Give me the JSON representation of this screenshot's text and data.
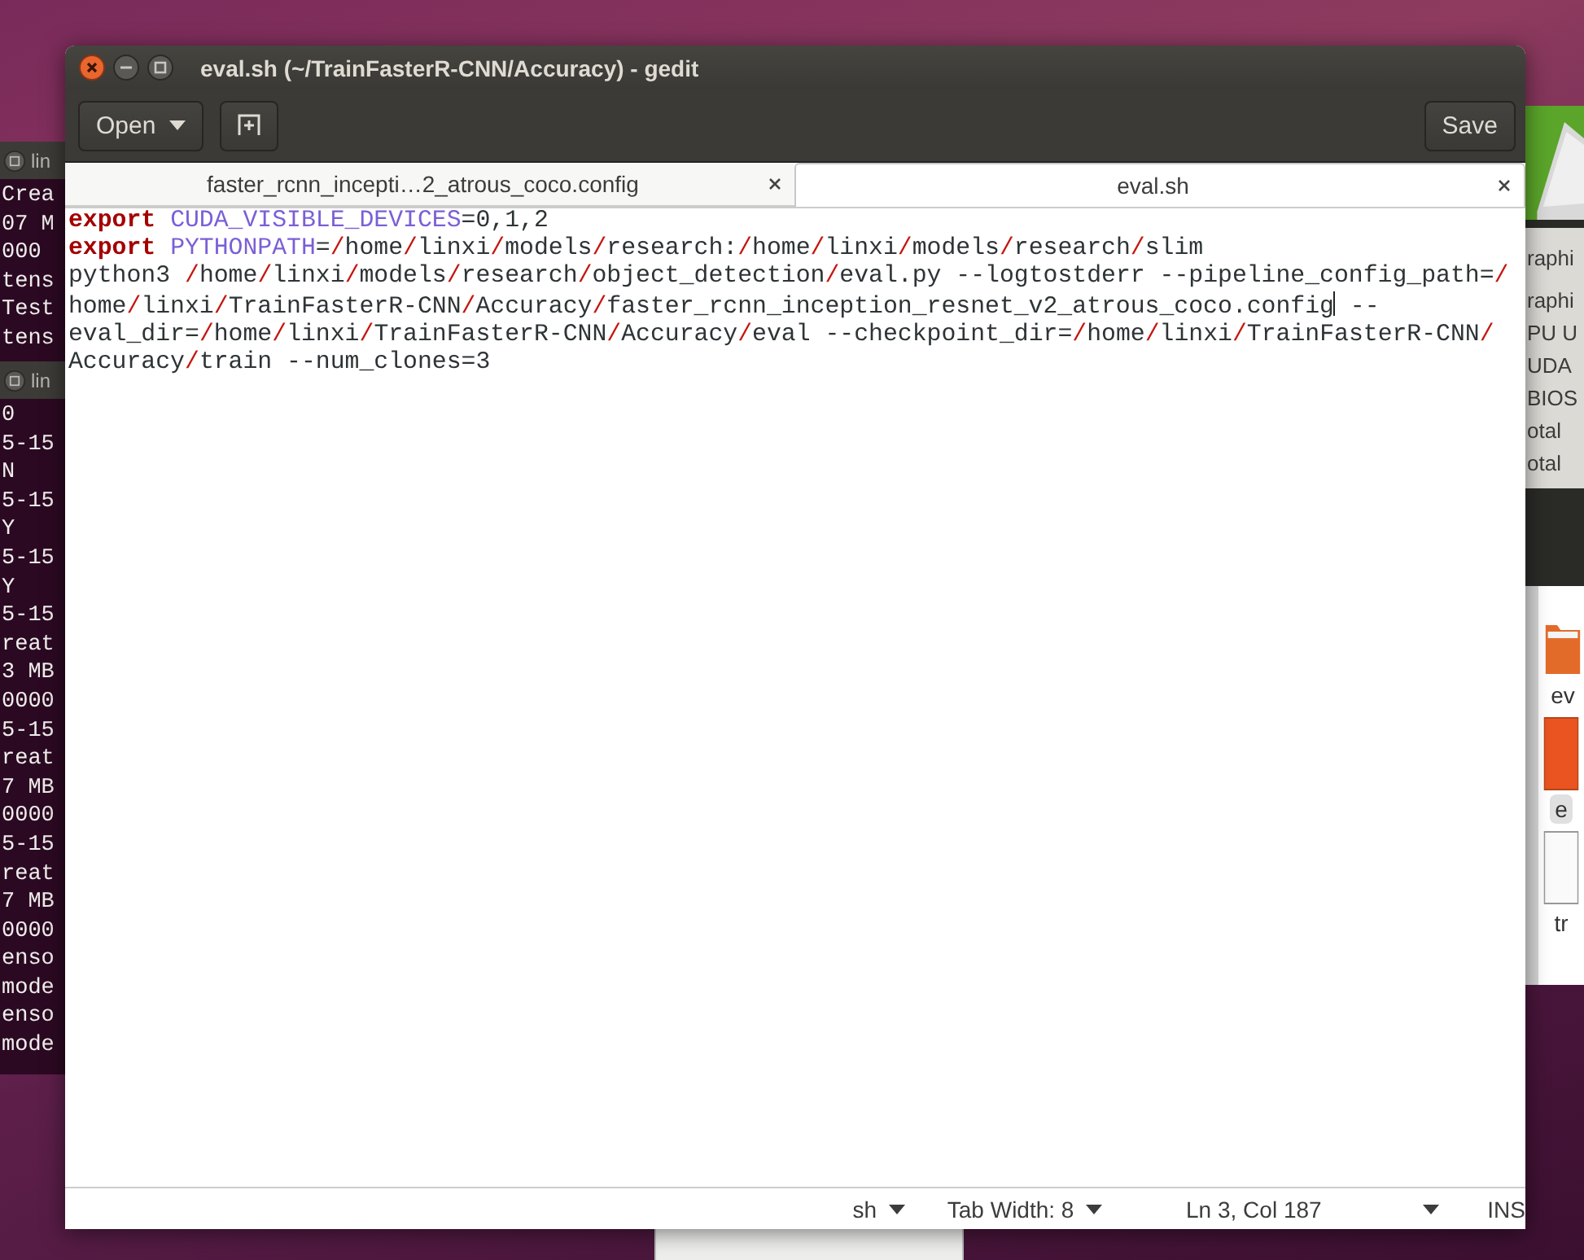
{
  "desktop": {
    "terminals": [
      {
        "title": "lin",
        "lines": [
          "Crea",
          "07 M",
          "000",
          "tens",
          "Test",
          "tens"
        ]
      },
      {
        "title": "lin",
        "lines": [
          "0",
          "5-15",
          "N",
          "5-15",
          "Y",
          "5-15",
          "Y",
          "5-15",
          "reat",
          "3 MB",
          "0000",
          "5-15",
          "reat",
          "7 MB",
          "0000",
          "5-15",
          "reat",
          "7 MB",
          "0000",
          "enso",
          "mode",
          "enso",
          "mode"
        ]
      }
    ],
    "info_window": {
      "lines": [
        "raphi",
        "raphi",
        "PU U",
        "UDA",
        "BIOS",
        "otal",
        "otal"
      ]
    },
    "files_window": {
      "items": [
        {
          "kind": "folder",
          "label": "ev",
          "selected": false
        },
        {
          "kind": "script",
          "label": "e",
          "selected": true
        },
        {
          "kind": "document",
          "label": "tr",
          "selected": false
        }
      ]
    }
  },
  "window": {
    "title": "eval.sh (~/TrainFasterR-CNN/Accuracy) - gedit",
    "toolbar": {
      "open_button": "Open",
      "save_button": "Save"
    },
    "tabs": [
      {
        "label": "faster_rcnn_incepti…2_atrous_coco.config",
        "selected": false
      },
      {
        "label": "eval.sh",
        "selected": true
      }
    ],
    "editor": {
      "rows": [
        {
          "segments": [
            {
              "kind": "keyword",
              "text": "export "
            },
            {
              "kind": "variable",
              "text": "CUDA_VISIBLE_DEVICES"
            },
            {
              "kind": "plain",
              "text": "=0,1,2"
            }
          ]
        },
        {
          "segments": [
            {
              "kind": "keyword",
              "text": "export "
            },
            {
              "kind": "variable",
              "text": "PYTHONPATH"
            },
            {
              "kind": "plain",
              "text": "=/home/linxi/models/research:/home/linxi/models/research/slim"
            }
          ]
        },
        {
          "segments": [
            {
              "kind": "plain",
              "text": "python3 /home/linxi/models/research/object_detection/eval.py --logtostderr --pipeline_config_path=/"
            }
          ]
        },
        {
          "segments": [
            {
              "kind": "plain",
              "text": "home/linxi/TrainFasterR-CNN/Accuracy/faster_rcnn_inception_resnet_v2_atrous_coco.config"
            },
            {
              "kind": "cursor"
            },
            {
              "kind": "plain",
              "text": " --"
            }
          ]
        },
        {
          "segments": [
            {
              "kind": "plain",
              "text": "eval_dir=/home/linxi/TrainFasterR-CNN/Accuracy/eval --checkpoint_dir=/home/linxi/TrainFasterR-CNN/"
            }
          ]
        },
        {
          "segments": [
            {
              "kind": "plain",
              "text": "Accuracy/train --num_clones=3"
            }
          ]
        }
      ]
    },
    "status_bar": {
      "language": "sh",
      "tab_width": "Tab Width: 8",
      "position": "Ln 3, Col 187",
      "mode": "INS"
    }
  }
}
